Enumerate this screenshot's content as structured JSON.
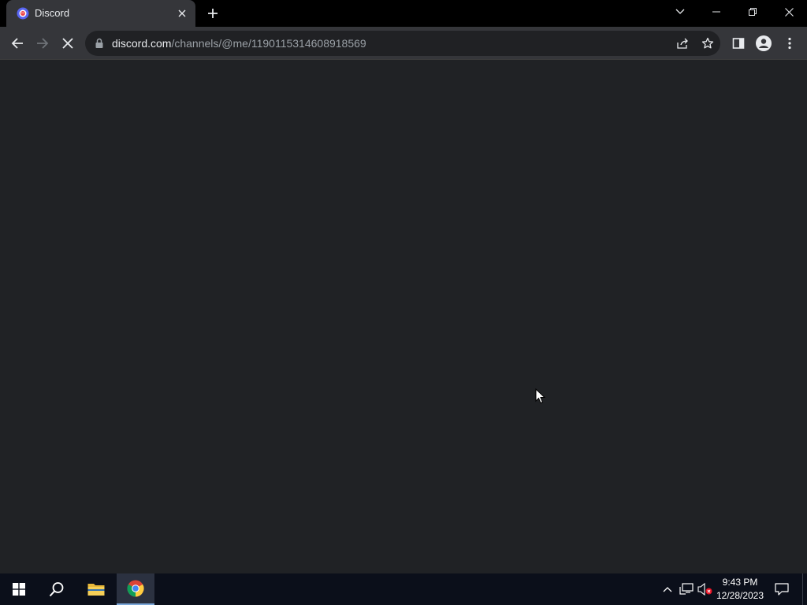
{
  "browser": {
    "tab": {
      "title": "Discord"
    },
    "address": {
      "host": "discord.com",
      "path": "/channels/@me/1190115314608918569"
    }
  },
  "taskbar": {
    "clock": {
      "time": "9:43 PM",
      "date": "12/28/2023"
    }
  },
  "icons": {
    "favicon": "discord-favicon-icon",
    "tab_close": "close-icon",
    "new_tab": "plus-icon",
    "back": "arrow-left-icon",
    "forward": "arrow-right-icon",
    "stop": "stop-loading-icon",
    "lock": "lock-icon",
    "share": "share-icon",
    "bookmark": "star-icon",
    "side_panel": "side-panel-icon",
    "profile": "profile-icon",
    "menu": "kebab-menu-icon"
  },
  "colors": {
    "content_bg": "#202225",
    "tab_strip": "#000000",
    "toolbar": "#35363a",
    "taskbar": "#0b0f1a"
  }
}
